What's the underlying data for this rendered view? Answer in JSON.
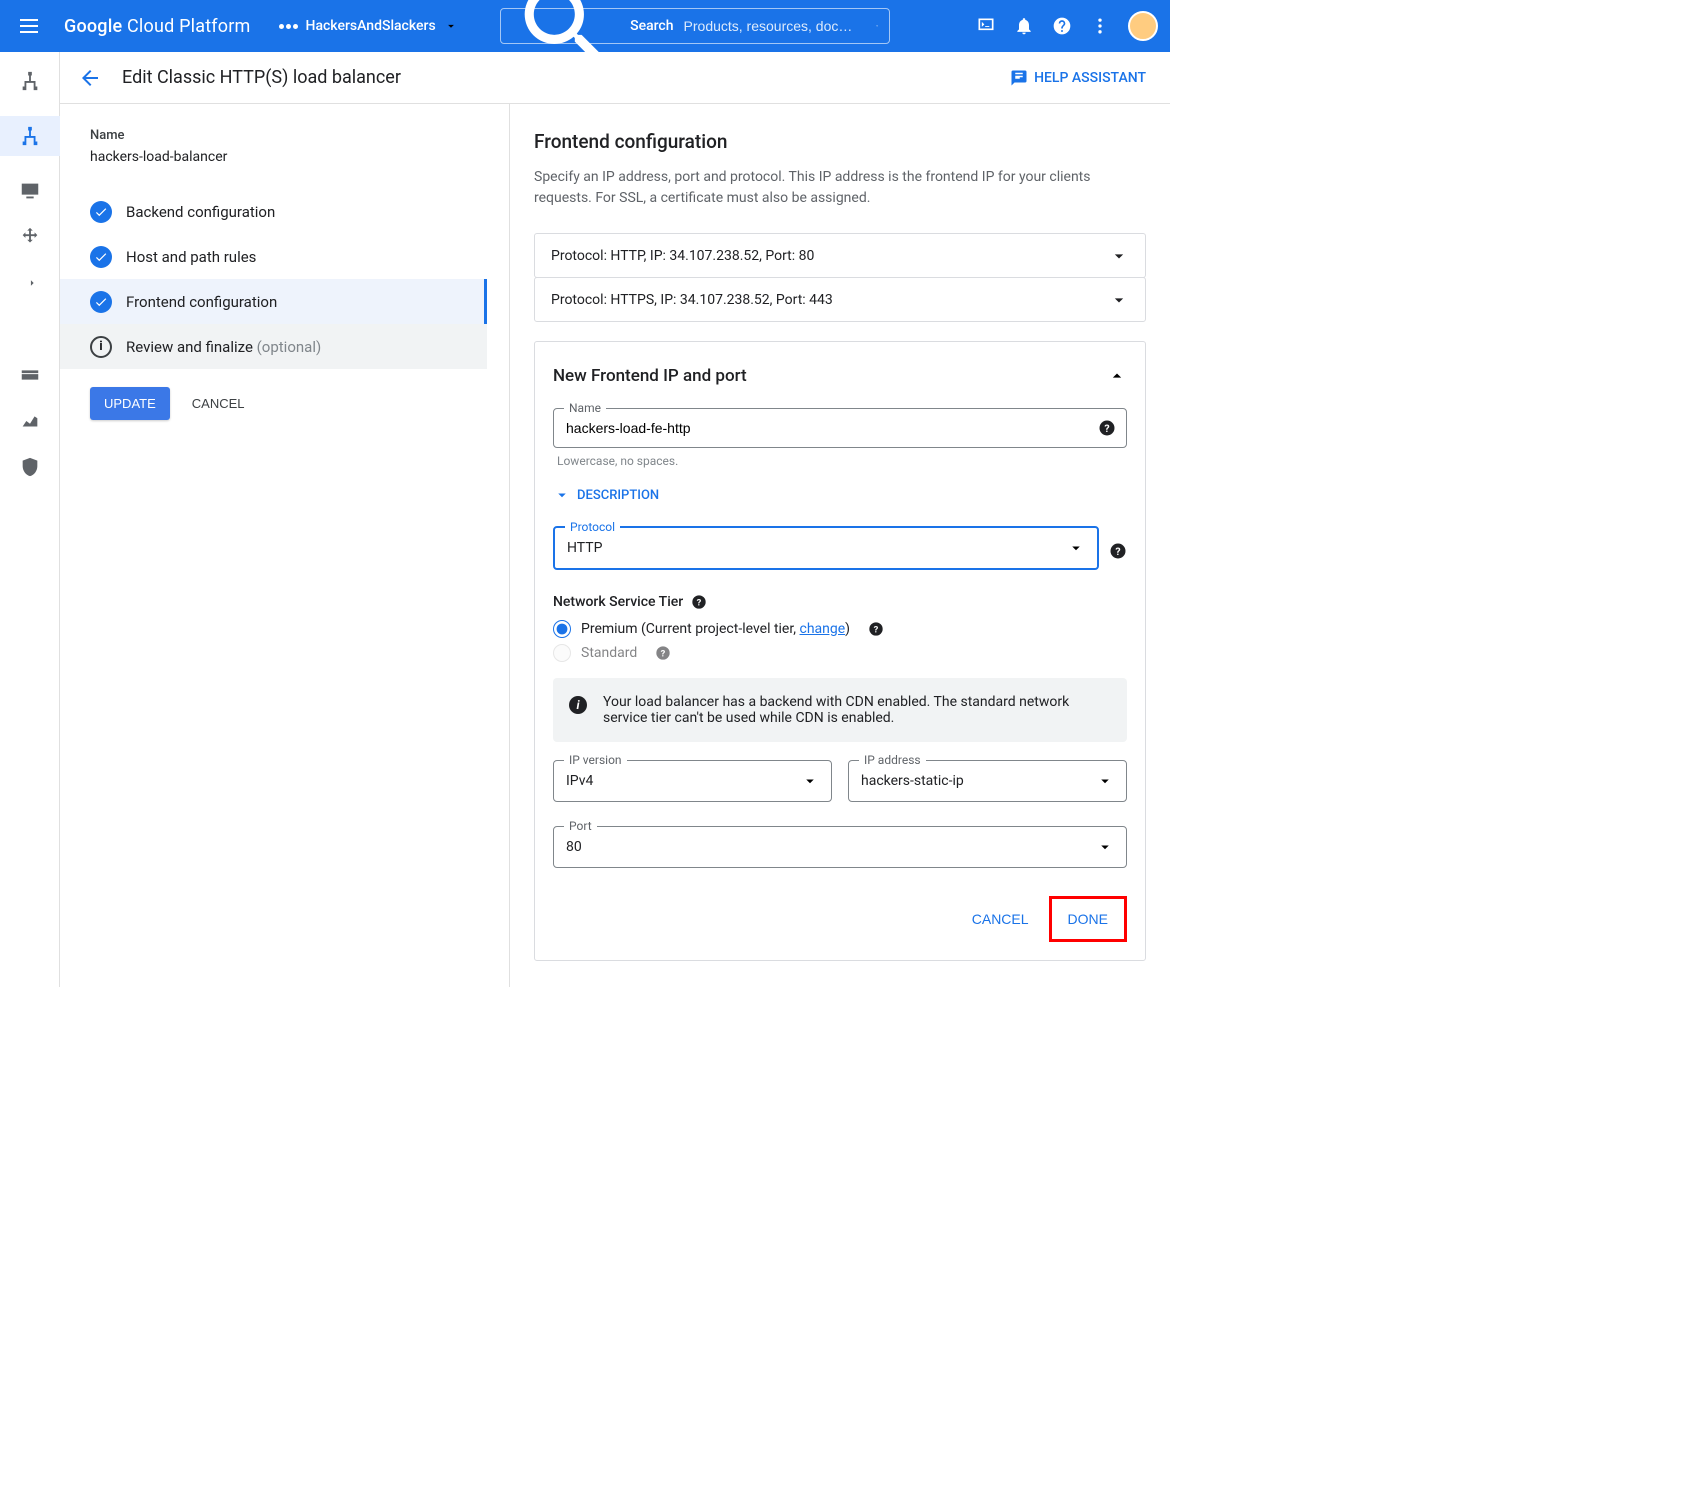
{
  "header": {
    "brand_prefix": "Google",
    "brand_rest": " Cloud Platform",
    "project": "HackersAndSlackers",
    "search_label": "Search",
    "search_placeholder": "Products, resources, doc…"
  },
  "page": {
    "title": "Edit Classic HTTP(S) load balancer",
    "help": "HELP ASSISTANT"
  },
  "left": {
    "name_label": "Name",
    "name_value": "hackers-load-balancer",
    "steps": {
      "backend": "Backend configuration",
      "hostpath": "Host and path rules",
      "frontend": "Frontend configuration",
      "review": "Review and finalize",
      "review_opt": "(optional)"
    },
    "update": "UPDATE",
    "cancel": "CANCEL"
  },
  "right": {
    "title": "Frontend configuration",
    "desc": "Specify an IP address, port and protocol. This IP address is the frontend IP for your clients requests. For SSL, a certificate must also be assigned.",
    "acc1": "Protocol: HTTP, IP: 34.107.238.52, Port: 80",
    "acc2": "Protocol: HTTPS, IP: 34.107.238.52, Port: 443",
    "panel_title": "New Frontend IP and port",
    "name_label": "Name",
    "name_value": "hackers-load-fe-http",
    "name_hint": "Lowercase, no spaces.",
    "description": "DESCRIPTION",
    "protocol_label": "Protocol",
    "protocol_value": "HTTP",
    "tier_label": "Network Service Tier",
    "premium_prefix": "Premium (Current project-level tier, ",
    "premium_link": "change",
    "premium_suffix": ")",
    "standard": "Standard",
    "info": "Your load balancer has a backend with CDN enabled. The standard network service tier can't be used while CDN is enabled.",
    "ipver_label": "IP version",
    "ipver_value": "IPv4",
    "ipaddr_label": "IP address",
    "ipaddr_value": "hackers-static-ip",
    "port_label": "Port",
    "port_value": "80",
    "cancel": "CANCEL",
    "done": "DONE"
  }
}
